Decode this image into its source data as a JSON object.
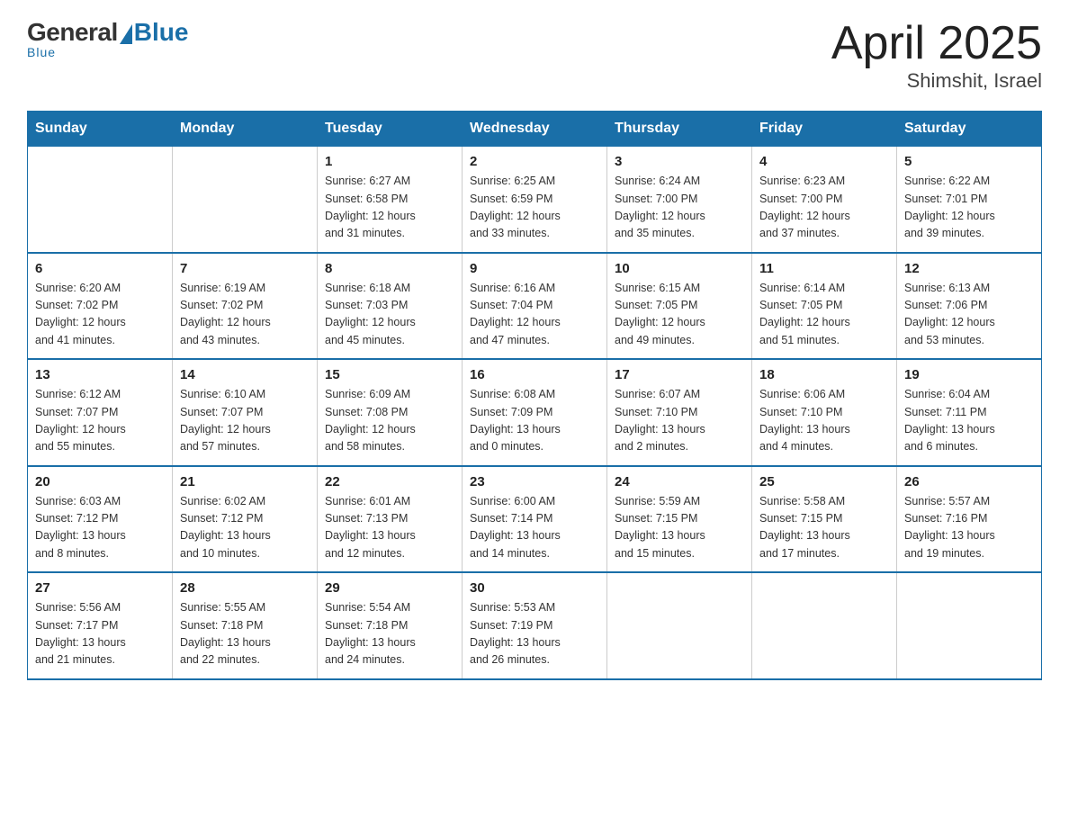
{
  "header": {
    "logo": {
      "general": "General",
      "blue": "Blue",
      "underline": "Blue"
    },
    "title": "April 2025",
    "subtitle": "Shimshit, Israel"
  },
  "weekdays": [
    "Sunday",
    "Monday",
    "Tuesday",
    "Wednesday",
    "Thursday",
    "Friday",
    "Saturday"
  ],
  "weeks": [
    [
      {
        "day": "",
        "info": ""
      },
      {
        "day": "",
        "info": ""
      },
      {
        "day": "1",
        "info": "Sunrise: 6:27 AM\nSunset: 6:58 PM\nDaylight: 12 hours\nand 31 minutes."
      },
      {
        "day": "2",
        "info": "Sunrise: 6:25 AM\nSunset: 6:59 PM\nDaylight: 12 hours\nand 33 minutes."
      },
      {
        "day": "3",
        "info": "Sunrise: 6:24 AM\nSunset: 7:00 PM\nDaylight: 12 hours\nand 35 minutes."
      },
      {
        "day": "4",
        "info": "Sunrise: 6:23 AM\nSunset: 7:00 PM\nDaylight: 12 hours\nand 37 minutes."
      },
      {
        "day": "5",
        "info": "Sunrise: 6:22 AM\nSunset: 7:01 PM\nDaylight: 12 hours\nand 39 minutes."
      }
    ],
    [
      {
        "day": "6",
        "info": "Sunrise: 6:20 AM\nSunset: 7:02 PM\nDaylight: 12 hours\nand 41 minutes."
      },
      {
        "day": "7",
        "info": "Sunrise: 6:19 AM\nSunset: 7:02 PM\nDaylight: 12 hours\nand 43 minutes."
      },
      {
        "day": "8",
        "info": "Sunrise: 6:18 AM\nSunset: 7:03 PM\nDaylight: 12 hours\nand 45 minutes."
      },
      {
        "day": "9",
        "info": "Sunrise: 6:16 AM\nSunset: 7:04 PM\nDaylight: 12 hours\nand 47 minutes."
      },
      {
        "day": "10",
        "info": "Sunrise: 6:15 AM\nSunset: 7:05 PM\nDaylight: 12 hours\nand 49 minutes."
      },
      {
        "day": "11",
        "info": "Sunrise: 6:14 AM\nSunset: 7:05 PM\nDaylight: 12 hours\nand 51 minutes."
      },
      {
        "day": "12",
        "info": "Sunrise: 6:13 AM\nSunset: 7:06 PM\nDaylight: 12 hours\nand 53 minutes."
      }
    ],
    [
      {
        "day": "13",
        "info": "Sunrise: 6:12 AM\nSunset: 7:07 PM\nDaylight: 12 hours\nand 55 minutes."
      },
      {
        "day": "14",
        "info": "Sunrise: 6:10 AM\nSunset: 7:07 PM\nDaylight: 12 hours\nand 57 minutes."
      },
      {
        "day": "15",
        "info": "Sunrise: 6:09 AM\nSunset: 7:08 PM\nDaylight: 12 hours\nand 58 minutes."
      },
      {
        "day": "16",
        "info": "Sunrise: 6:08 AM\nSunset: 7:09 PM\nDaylight: 13 hours\nand 0 minutes."
      },
      {
        "day": "17",
        "info": "Sunrise: 6:07 AM\nSunset: 7:10 PM\nDaylight: 13 hours\nand 2 minutes."
      },
      {
        "day": "18",
        "info": "Sunrise: 6:06 AM\nSunset: 7:10 PM\nDaylight: 13 hours\nand 4 minutes."
      },
      {
        "day": "19",
        "info": "Sunrise: 6:04 AM\nSunset: 7:11 PM\nDaylight: 13 hours\nand 6 minutes."
      }
    ],
    [
      {
        "day": "20",
        "info": "Sunrise: 6:03 AM\nSunset: 7:12 PM\nDaylight: 13 hours\nand 8 minutes."
      },
      {
        "day": "21",
        "info": "Sunrise: 6:02 AM\nSunset: 7:12 PM\nDaylight: 13 hours\nand 10 minutes."
      },
      {
        "day": "22",
        "info": "Sunrise: 6:01 AM\nSunset: 7:13 PM\nDaylight: 13 hours\nand 12 minutes."
      },
      {
        "day": "23",
        "info": "Sunrise: 6:00 AM\nSunset: 7:14 PM\nDaylight: 13 hours\nand 14 minutes."
      },
      {
        "day": "24",
        "info": "Sunrise: 5:59 AM\nSunset: 7:15 PM\nDaylight: 13 hours\nand 15 minutes."
      },
      {
        "day": "25",
        "info": "Sunrise: 5:58 AM\nSunset: 7:15 PM\nDaylight: 13 hours\nand 17 minutes."
      },
      {
        "day": "26",
        "info": "Sunrise: 5:57 AM\nSunset: 7:16 PM\nDaylight: 13 hours\nand 19 minutes."
      }
    ],
    [
      {
        "day": "27",
        "info": "Sunrise: 5:56 AM\nSunset: 7:17 PM\nDaylight: 13 hours\nand 21 minutes."
      },
      {
        "day": "28",
        "info": "Sunrise: 5:55 AM\nSunset: 7:18 PM\nDaylight: 13 hours\nand 22 minutes."
      },
      {
        "day": "29",
        "info": "Sunrise: 5:54 AM\nSunset: 7:18 PM\nDaylight: 13 hours\nand 24 minutes."
      },
      {
        "day": "30",
        "info": "Sunrise: 5:53 AM\nSunset: 7:19 PM\nDaylight: 13 hours\nand 26 minutes."
      },
      {
        "day": "",
        "info": ""
      },
      {
        "day": "",
        "info": ""
      },
      {
        "day": "",
        "info": ""
      }
    ]
  ]
}
